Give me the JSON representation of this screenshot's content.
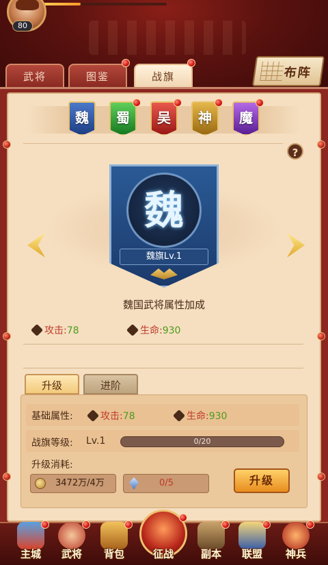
{
  "player": {
    "level": "80"
  },
  "tabs": [
    {
      "label": "武将",
      "active": false,
      "badge": false
    },
    {
      "label": "图鉴",
      "active": false,
      "badge": true
    },
    {
      "label": "战旗",
      "active": true,
      "badge": true
    }
  ],
  "formation_button": {
    "label": "布阵"
  },
  "factions": [
    {
      "label": "魏",
      "color": "#2a56a8",
      "badge": false
    },
    {
      "label": "蜀",
      "color": "#1f8a2e",
      "badge": true
    },
    {
      "label": "吴",
      "color": "#b32820",
      "badge": true
    },
    {
      "label": "神",
      "color": "#c08a1c",
      "badge": true
    },
    {
      "label": "魔",
      "color": "#7a2bb8",
      "badge": true
    }
  ],
  "help_icon": "?",
  "banner": {
    "emblem": "魏",
    "label": "魏旗Lv.1",
    "bonus_title": "魏国武将属性加成"
  },
  "stats_top": [
    {
      "label": "攻击:",
      "value": "78",
      "icon": "sword-icon"
    },
    {
      "label": "生命:",
      "value": "930",
      "icon": "heart-shield-icon"
    }
  ],
  "subtabs": [
    {
      "label": "升级",
      "active": true
    },
    {
      "label": "进阶",
      "active": false
    }
  ],
  "upgrade": {
    "base_attr_label": "基础属性:",
    "attack_label": "攻击:",
    "attack_value": "78",
    "hp_label": "生命:",
    "hp_value": "930",
    "flag_level_label": "战旗等级:",
    "flag_level_value": "Lv.1",
    "progress_text": "0/20",
    "progress": 0.0,
    "cost_label": "升级消耗:",
    "gold_cost": "3472万/4万",
    "crystal_cost": "0/5",
    "button_label": "升级"
  },
  "bottom_nav": [
    {
      "label": "主城",
      "badge": true
    },
    {
      "label": "武将",
      "badge": true
    },
    {
      "label": "背包",
      "badge": true
    },
    {
      "label": "征战",
      "badge": true
    },
    {
      "label": "副本",
      "badge": true
    },
    {
      "label": "联盟",
      "badge": true
    },
    {
      "label": "神兵",
      "badge": true
    }
  ],
  "colors": {
    "accent_red": "#c0392b",
    "value_green": "#4e9a1d",
    "panel_bg": "#f5dfc0"
  }
}
